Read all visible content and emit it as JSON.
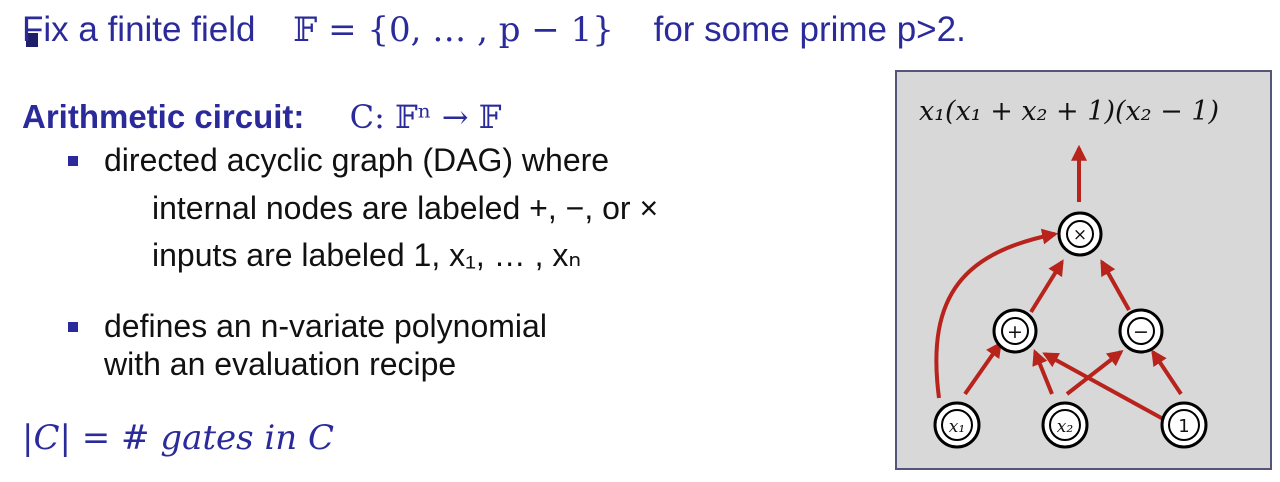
{
  "line1": {
    "text_a": "Fix a finite field",
    "math": "𝔽 = {0, … , p − 1}",
    "text_b": "for some prime  p>2."
  },
  "heading": {
    "label": "Arithmetic circuit",
    "colon": ":",
    "math": "C: 𝔽ⁿ  →  𝔽"
  },
  "bullets": [
    {
      "lines": [
        "directed acyclic graph (DAG) where",
        "internal nodes are labeled  +, −, or ×",
        "inputs are labeled   1, x₁, … , xₙ"
      ]
    },
    {
      "lines": [
        "defines an n-variate polynomial",
        "with an evaluation recipe"
      ]
    }
  ],
  "size_line": "|C|  = # gates in C",
  "diagram": {
    "output_label": "x₁(x₁ + x₂ + 1)(x₂ − 1)",
    "nodes": {
      "mult": "×",
      "plus": "+",
      "minus": "−",
      "x1": "x₁",
      "x2": "x₂",
      "one": "1"
    },
    "colors": {
      "edge": "#b8231c",
      "panel": "#d8d8d8",
      "text": "#2a2a9a"
    }
  }
}
